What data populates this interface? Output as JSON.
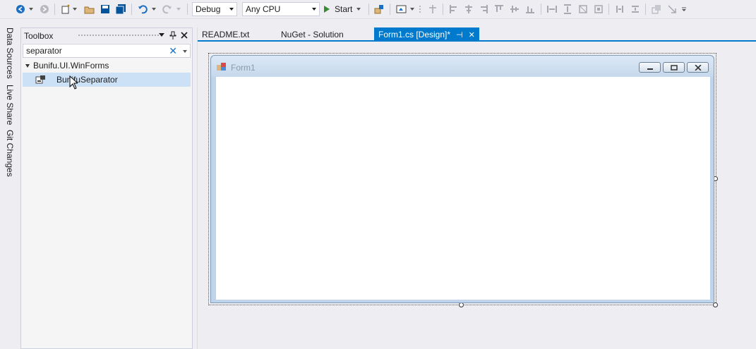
{
  "toolbar": {
    "config": "Debug",
    "platform": "Any CPU",
    "start_label": "Start"
  },
  "side_tabs": [
    "Data Sources",
    "Live Share",
    "Git Changes"
  ],
  "toolbox": {
    "title": "Toolbox",
    "search_value": "separator",
    "group": "Bunifu.UI.WinForms",
    "item": "BunifuSeparator"
  },
  "tabs": {
    "readme": "README.txt",
    "nuget": "NuGet - Solution",
    "form_design": "Form1.cs [Design]*"
  },
  "form": {
    "title": "Form1"
  },
  "colors": {
    "accent": "#007acc",
    "selection": "#cce0f6",
    "start_green": "#388a34"
  }
}
